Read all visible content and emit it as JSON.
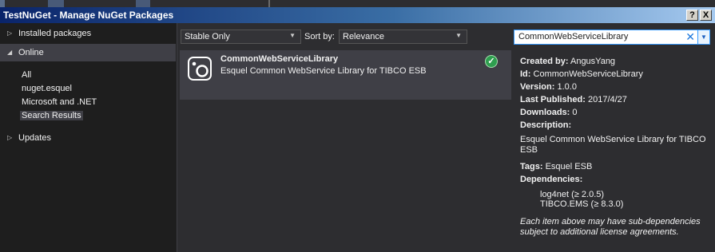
{
  "window": {
    "title": "TestNuGet - Manage NuGet Packages",
    "help_label": "?",
    "close_label": "X"
  },
  "nav": {
    "installed": "Installed packages",
    "online": "Online",
    "online_items": [
      "All",
      "nuget.esquel",
      "Microsoft and .NET",
      "Search Results"
    ],
    "updates": "Updates"
  },
  "toolbar": {
    "filter_value": "Stable Only",
    "sortby_label": "Sort by:",
    "sortby_value": "Relevance",
    "search_value": "CommonWebServiceLibrary"
  },
  "package": {
    "name": "CommonWebServiceLibrary",
    "description": "Esquel Common WebService Library for TIBCO ESB"
  },
  "details": {
    "created_by_label": "Created by:",
    "created_by": "AngusYang",
    "id_label": "Id:",
    "id": "CommonWebServiceLibrary",
    "version_label": "Version:",
    "version": "1.0.0",
    "last_published_label": "Last Published:",
    "last_published": "2017/4/27",
    "downloads_label": "Downloads:",
    "downloads": "0",
    "description_label": "Description:",
    "description_line1": "Esquel Common WebService Library for TIBCO",
    "description_line2": "ESB",
    "tags_label": "Tags:",
    "tags": "Esquel ESB",
    "dependencies_label": "Dependencies:",
    "dependencies": [
      "log4net (≥ 2.0.5)",
      "TIBCO.EMS (≥ 8.3.0)"
    ],
    "note_line1": "Each item above may have sub-dependencies",
    "note_line2": "subject to additional license agreements."
  },
  "colors": {
    "accent": "#3399ff",
    "selected": "#3f3f46",
    "installed_check": "#2e9e4f"
  }
}
